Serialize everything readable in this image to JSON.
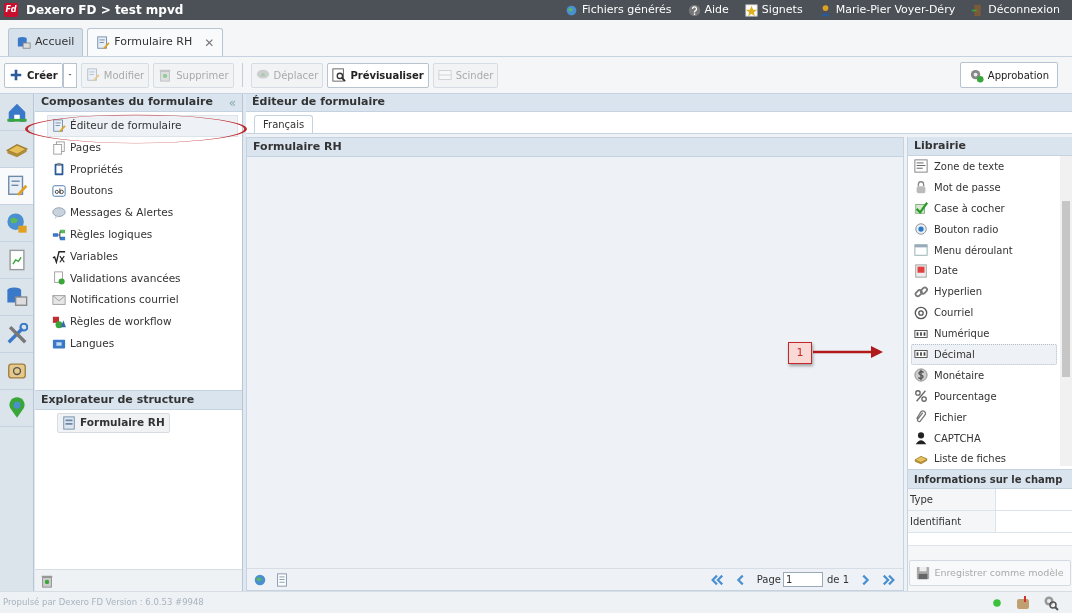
{
  "app_bar": {
    "title": "Dexero FD > test mpvd",
    "logo": "Fd",
    "links": [
      {
        "label": "Fichiers générés"
      },
      {
        "label": "Aide"
      },
      {
        "label": "Signets"
      },
      {
        "label": "Marie-Pier Voyer-Déry"
      },
      {
        "label": "Déconnexion"
      }
    ]
  },
  "tabs": [
    {
      "label": "Accueil",
      "selected": false,
      "closable": false
    },
    {
      "label": "Formulaire RH",
      "selected": true,
      "closable": true,
      "close": "✕"
    }
  ],
  "toolbar": {
    "buttons": [
      {
        "label": "Créer",
        "disabled": false,
        "menu": true
      },
      {
        "label": "Modifier",
        "disabled": true,
        "menu": false
      },
      {
        "label": "Supprimer",
        "disabled": true,
        "menu": false
      },
      {
        "label": "Déplacer",
        "disabled": true,
        "menu": false
      },
      {
        "label": "Prévisualiser",
        "disabled": false,
        "menu": false
      },
      {
        "label": "Scinder",
        "disabled": true,
        "menu": false
      }
    ],
    "right_button": {
      "label": "Approbation",
      "disabled": false
    }
  },
  "side_strip": [
    {
      "selected": false
    },
    {
      "selected": false
    },
    {
      "selected": true
    },
    {
      "selected": false
    },
    {
      "selected": false
    },
    {
      "selected": false
    },
    {
      "selected": false
    },
    {
      "selected": false
    },
    {
      "selected": false
    }
  ],
  "components_panel": {
    "title": "Composantes du formulaire",
    "collapse": "«",
    "items": [
      {
        "label": "Éditeur de formulaire",
        "selected": true
      },
      {
        "label": "Pages",
        "selected": false
      },
      {
        "label": "Propriétés",
        "selected": false
      },
      {
        "label": "Boutons",
        "selected": false
      },
      {
        "label": "Messages & Alertes",
        "selected": false
      },
      {
        "label": "Règles logiques",
        "selected": false
      },
      {
        "label": "Variables",
        "selected": false
      },
      {
        "label": "Validations avancées",
        "selected": false
      },
      {
        "label": "Notifications courriel",
        "selected": false
      },
      {
        "label": "Règles de workflow",
        "selected": false
      },
      {
        "label": "Langues",
        "selected": false
      }
    ]
  },
  "structure_panel": {
    "title": "Explorateur de structure",
    "items": [
      {
        "label": "Formulaire RH"
      }
    ]
  },
  "editor": {
    "title": "Éditeur de formulaire",
    "tabs": [
      {
        "label": "Français",
        "selected": true
      }
    ],
    "form_title": "Formulaire RH",
    "pager": {
      "page_label": "Page",
      "page": "1",
      "of": "de 1"
    }
  },
  "library": {
    "title": "Librairie",
    "items": [
      {
        "label": "Zone de texte",
        "selected": false
      },
      {
        "label": "Mot de passe",
        "selected": false
      },
      {
        "label": "Case à cocher",
        "selected": false
      },
      {
        "label": "Bouton radio",
        "selected": false
      },
      {
        "label": "Menu déroulant",
        "selected": false
      },
      {
        "label": "Date",
        "selected": false
      },
      {
        "label": "Hyperlien",
        "selected": false
      },
      {
        "label": "Courriel",
        "selected": false
      },
      {
        "label": "Numérique",
        "selected": false
      },
      {
        "label": "Décimal",
        "selected": true
      },
      {
        "label": "Monétaire",
        "selected": false
      },
      {
        "label": "Pourcentage",
        "selected": false
      },
      {
        "label": "Fichier",
        "selected": false
      },
      {
        "label": "CAPTCHA",
        "selected": false
      },
      {
        "label": "Liste de fiches",
        "selected": false
      }
    ]
  },
  "field_info": {
    "title": "Informations sur le champ",
    "rows": [
      {
        "label": "Type"
      },
      {
        "label": "Identifiant"
      }
    ],
    "save_button": {
      "label": "Enregistrer comme modèle",
      "disabled": true
    }
  },
  "callout": {
    "number": "1"
  },
  "footer": {
    "text": "Propulsé par Dexero FD Version : 6.0.53 #9948"
  }
}
